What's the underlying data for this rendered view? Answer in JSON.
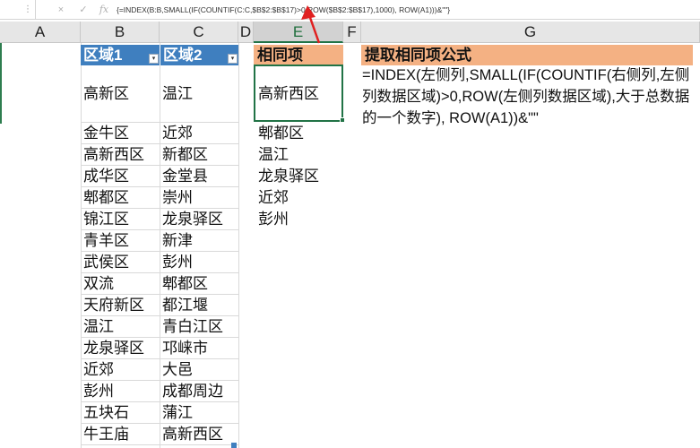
{
  "formula_bar": {
    "cancel_icon": "×",
    "enter_icon": "✓",
    "function_icon": "fx",
    "formula": "{=INDEX(B:B,SMALL(IF(COUNTIF(C:C,$B$2:$B$17)>0,ROW($B$2:$B$17),1000), ROW(A1)))&\"\"}"
  },
  "columns": [
    "A",
    "B",
    "C",
    "D",
    "E",
    "F",
    "G"
  ],
  "table": {
    "header_b": "区域1",
    "header_c": "区域2",
    "filter_icon": "▾",
    "col_b": [
      "高新区",
      "金牛区",
      "高新西区",
      "成华区",
      "郫都区",
      "锦江区",
      "青羊区",
      "武侯区",
      "双流",
      "天府新区",
      "温江",
      "龙泉驿区",
      "近郊",
      "彭州",
      "五块石",
      "牛王庙"
    ],
    "col_c": [
      "温江",
      "近郊",
      "新都区",
      "金堂县",
      "崇州",
      "龙泉驿区",
      "新津",
      "彭州",
      "郫都区",
      "都江堰",
      "青白江区",
      "邛崃市",
      "大邑",
      "成都周边",
      "蒲江",
      "高新西区"
    ]
  },
  "result": {
    "header": "相同项",
    "values": [
      "高新西区",
      "郫都区",
      "温江",
      "龙泉驿区",
      "近郊",
      "彭州"
    ]
  },
  "explanation": {
    "header": "提取相同项公式",
    "text": "=INDEX(左侧列,SMALL(IF(COUNTIF(右侧列,左侧列数据区域)>0,ROW(左侧列数据区域),大于总数据的一个数字), ROW(A1))&\"\""
  },
  "colors": {
    "table_header": "#3f7fbf",
    "orange_header": "#f4b183",
    "selection": "#217346",
    "arrow": "#e02020"
  }
}
